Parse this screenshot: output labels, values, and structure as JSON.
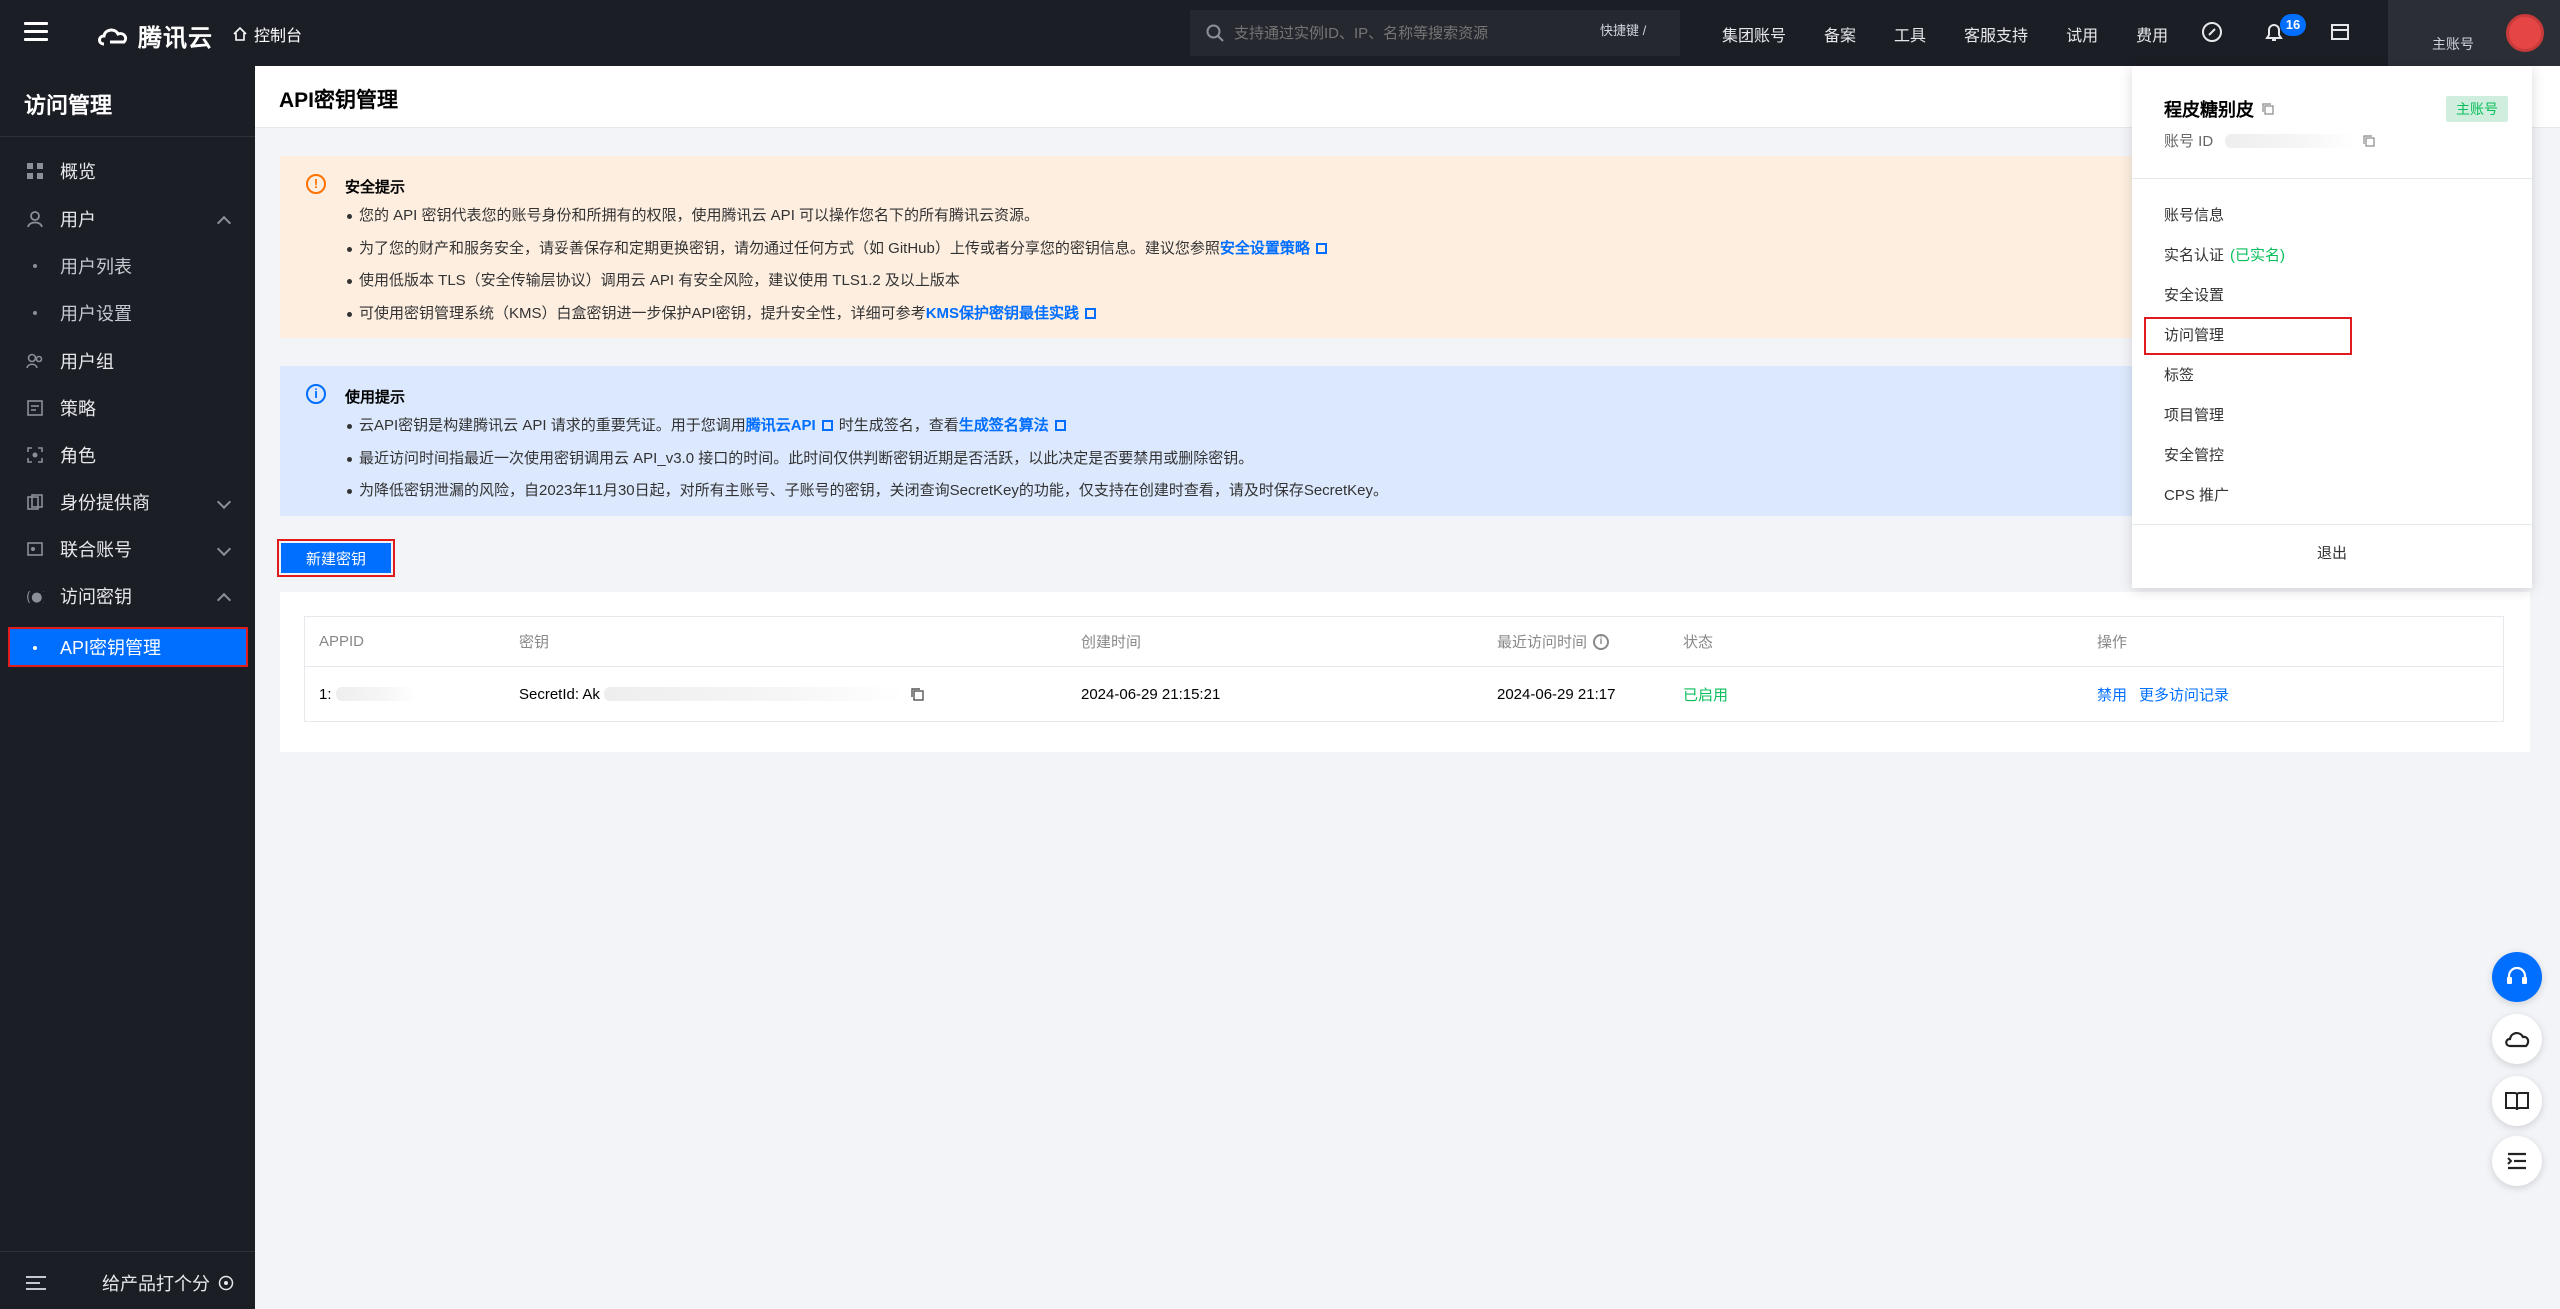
{
  "topbar": {
    "brand": "腾讯云",
    "console": "控制台",
    "search_placeholder": "支持通过实例ID、IP、名称等搜索资源",
    "shortcut": "快捷键 /",
    "nav": [
      "集团账号",
      "备案",
      "工具",
      "客服支持",
      "试用",
      "费用"
    ],
    "notification_count": "16",
    "account_label": "主账号"
  },
  "sidebar": {
    "title": "访问管理",
    "items": [
      {
        "label": "概览",
        "icon": "grid-icon"
      },
      {
        "label": "用户",
        "icon": "user-icon"
      },
      {
        "label": "用户列表"
      },
      {
        "label": "用户设置"
      },
      {
        "label": "用户组",
        "icon": "users-icon"
      },
      {
        "label": "策略",
        "icon": "policy-icon"
      },
      {
        "label": "角色",
        "icon": "role-icon"
      },
      {
        "label": "身份提供商",
        "icon": "idp-icon"
      },
      {
        "label": "联合账号",
        "icon": "federation-icon"
      },
      {
        "label": "访问密钥",
        "icon": "key-icon"
      },
      {
        "label": "API密钥管理"
      }
    ],
    "footer_rate": "给产品打个分"
  },
  "page": {
    "title": "API密钥管理"
  },
  "security_notice": {
    "title": "安全提示",
    "l1": "您的 API 密钥代表您的账号身份和所拥有的权限，使用腾讯云 API 可以操作您名下的所有腾讯云资源。",
    "l2_pre": "为了您的财产和服务安全，请妥善保存和定期更换密钥，请勿通过任何方式（如 GitHub）上传或者分享您的密钥信息。建议您参照",
    "l2_link": "安全设置策略",
    "l3": "使用低版本 TLS（安全传输层协议）调用云 API 有安全风险，建议使用 TLS1.2 及以上版本",
    "l4_pre": "可使用密钥管理系统（KMS）白盒密钥进一步保护API密钥，提升安全性，详细可参考",
    "l4_link": "KMS保护密钥最佳实践"
  },
  "usage_notice": {
    "title": "使用提示",
    "l1_pre": "云API密钥是构建腾讯云 API 请求的重要凭证。用于您调用",
    "l1_link1": "腾讯云API",
    "l1_mid": "时生成签名，查看",
    "l1_link2": "生成签名算法",
    "l2": "最近访问时间指最近一次使用密钥调用云 API_v3.0 接口的时间。此时间仅供判断密钥近期是否活跃，以此决定是否要禁用或删除密钥。",
    "l3": "为降低密钥泄漏的风险，自2023年11月30日起，对所有主账号、子账号的密钥，关闭查询SecretKey的功能，仅支持在创建时查看，请及时保存SecretKey。"
  },
  "new_key_button": "新建密钥",
  "table": {
    "headers": [
      "APPID",
      "密钥",
      "创建时间",
      "最近访问时间",
      "状态",
      "操作"
    ],
    "rows": [
      {
        "appid": "1:",
        "secret": "SecretId: Ak",
        "created": "2024-06-29 21:15:21",
        "last_access": "2024-06-29 21:17",
        "status": "已启用",
        "op_disable": "禁用",
        "op_more": "更多访问记录"
      }
    ]
  },
  "account_menu": {
    "username": "程皮糖别皮",
    "badge": "主账号",
    "account_id_label": "账号 ID",
    "items": [
      "账号信息",
      "实名认证",
      "安全设置",
      "访问管理",
      "标签",
      "项目管理",
      "安全管控",
      "CPS 推广"
    ],
    "verified": "(已实名)",
    "logout": "退出"
  },
  "colors": {
    "accent": "#006eff",
    "success": "#0abf5b",
    "warning": "#ff7200",
    "highlight_border": "#e01b1b"
  }
}
